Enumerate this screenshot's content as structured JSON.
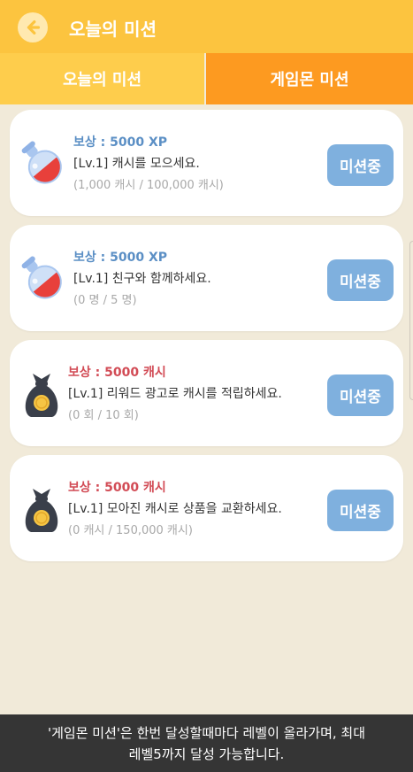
{
  "header": {
    "title": "오늘의 미션",
    "back_icon": "back-arrow-icon"
  },
  "tabs": [
    {
      "label": "오늘의 미션",
      "active": false
    },
    {
      "label": "게임몬 미션",
      "active": true
    }
  ],
  "missions": [
    {
      "reward": "보상 : 5000 XP",
      "title": "[Lv.1] 캐시를 모으세요.",
      "progress": "(1,000 캐시 / 100,000 캐시)",
      "button": "미션중",
      "icon": "potion-icon"
    },
    {
      "reward": "보상 : 5000 XP",
      "title": "[Lv.1] 친구와 함께하세요.",
      "progress": "(0 명 / 5 명)",
      "button": "미션중",
      "icon": "potion-icon"
    },
    {
      "reward": "보상 : 5000 캐시",
      "title": "[Lv.1] 리워드 광고로 캐시를 적립하세요.",
      "progress": "(0 회 / 10 회)",
      "button": "미션중",
      "icon": "money-bag-icon"
    },
    {
      "reward": "보상 : 5000 캐시",
      "title": "[Lv.1] 모아진 캐시로 상품을 교환하세요.",
      "progress": "(0 캐시 / 150,000 캐시)",
      "button": "미션중",
      "icon": "money-bag-icon"
    }
  ],
  "footer": {
    "line1": "'게임몬 미션'은 한번 달성할때마다 레벨이 올라가며, 최대",
    "line2": "레벨5까지 달성 가능합니다."
  },
  "colors": {
    "header": "#fcc43f",
    "tab_inactive": "#fecd4c",
    "tab_active": "#fd9a20",
    "reward_xp": "#5b8fc5",
    "reward_cash": "#d24b55",
    "button": "#7fb0de"
  }
}
